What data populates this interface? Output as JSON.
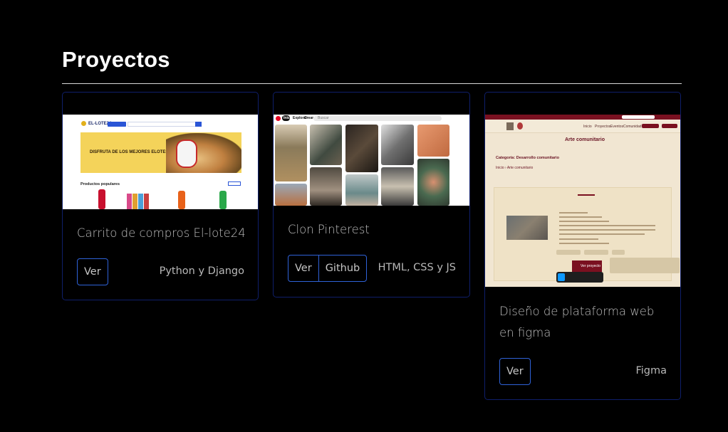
{
  "section": {
    "title": "Proyectos"
  },
  "projects": [
    {
      "title_lines": [
        "Carrito de compros El-lote24"
      ],
      "buttons": [
        "Ver"
      ],
      "tech": "Python y Django",
      "preview": {
        "logo": "EL-LOTE24",
        "banner": "DISFRUTA DE LOS MEJORES ELOTES",
        "section": "Productos populares"
      }
    },
    {
      "title_lines": [
        "Clon Pinterest"
      ],
      "buttons": [
        "Ver",
        "Github"
      ],
      "tech": "HTML, CSS y JS",
      "preview": {
        "nav": [
          "Inicio",
          "Explorar",
          "Crear"
        ],
        "search": "Buscar"
      }
    },
    {
      "title_lines": [
        "Diseño de plataforma web",
        "en figma"
      ],
      "buttons": [
        "Ver"
      ],
      "tech": "Figma",
      "preview": {
        "hero": "Arte comunitario",
        "category": "Categoría: Desarrollo comunitario",
        "crumb": "Inicio  ›  Arte comunitario",
        "nav": [
          "Inicio",
          "Proyectos",
          "Eventos",
          "Comunidad"
        ],
        "cta": "Ver proyecto"
      }
    }
  ],
  "colors": {
    "card_border": "#0f1f6b",
    "button_border": "#2f62d8",
    "background": "#000000"
  }
}
